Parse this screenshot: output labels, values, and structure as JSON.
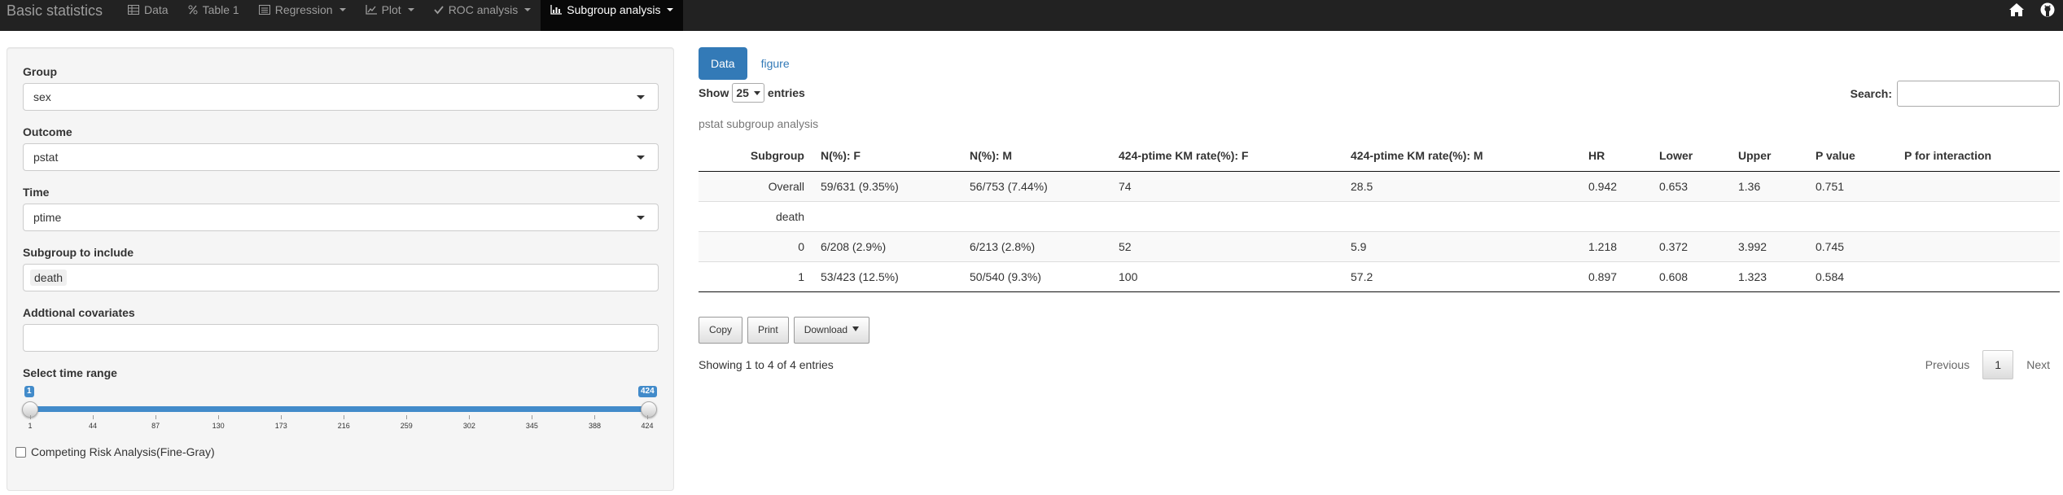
{
  "navbar": {
    "brand": "Basic statistics",
    "items": [
      {
        "label": "Data",
        "icon": "table-icon",
        "dropdown": false
      },
      {
        "label": "Table 1",
        "icon": "percent-icon",
        "dropdown": false
      },
      {
        "label": "Regression",
        "icon": "list-alt-icon",
        "dropdown": true
      },
      {
        "label": "Plot",
        "icon": "line-chart-icon",
        "dropdown": true
      },
      {
        "label": "ROC analysis",
        "icon": "check-icon",
        "dropdown": true
      },
      {
        "label": "Subgroup analysis",
        "icon": "bar-chart-icon",
        "dropdown": true,
        "active": true
      }
    ],
    "right_icons": [
      "home-icon",
      "github-icon"
    ]
  },
  "sidebar": {
    "group": {
      "label": "Group",
      "value": "sex"
    },
    "outcome": {
      "label": "Outcome",
      "value": "pstat"
    },
    "time": {
      "label": "Time",
      "value": "ptime"
    },
    "subgroup": {
      "label": "Subgroup to include",
      "tags": [
        "death"
      ]
    },
    "covariates": {
      "label": "Addtional covariates",
      "value": ""
    },
    "time_range": {
      "label": "Select time range",
      "min": 1,
      "max": 424,
      "from": 1,
      "to": 424,
      "ticks": [
        "1",
        "44",
        "87",
        "130",
        "173",
        "216",
        "259",
        "302",
        "345",
        "388",
        "424"
      ]
    },
    "competing_risk": {
      "label": "Competing Risk Analysis(Fine-Gray)",
      "checked": false
    }
  },
  "main": {
    "tabs": [
      {
        "label": "Data",
        "active": true
      },
      {
        "label": "figure",
        "active": false
      }
    ],
    "length": {
      "show_label": "Show",
      "value": "25",
      "entries_label": "entries"
    },
    "search": {
      "label": "Search:",
      "value": ""
    },
    "caption": "pstat subgroup analysis",
    "table": {
      "headers": [
        "Subgroup",
        "N(%): F",
        "N(%): M",
        "424-ptime KM rate(%): F",
        "424-ptime KM rate(%): M",
        "HR",
        "Lower",
        "Upper",
        "P value",
        "P for interaction"
      ],
      "rows": [
        [
          "Overall",
          "59/631 (9.35%)",
          "56/753 (7.44%)",
          "74",
          "28.5",
          "0.942",
          "0.653",
          "1.36",
          "0.751",
          ""
        ],
        [
          "death",
          "",
          "",
          "",
          "",
          "",
          "",
          "",
          "",
          ""
        ],
        [
          "0",
          "6/208 (2.9%)",
          "6/213 (2.8%)",
          "52",
          "5.9",
          "1.218",
          "0.372",
          "3.992",
          "0.745",
          ""
        ],
        [
          "1",
          "53/423 (12.5%)",
          "50/540 (9.3%)",
          "100",
          "57.2",
          "0.897",
          "0.608",
          "1.323",
          "0.584",
          ""
        ]
      ]
    },
    "buttons": {
      "copy": "Copy",
      "print": "Print",
      "download": "Download"
    },
    "info": "Showing 1 to 4 of 4 entries",
    "paging": {
      "previous": "Previous",
      "current": "1",
      "next": "Next"
    }
  },
  "colors": {
    "navbar_bg": "#222222",
    "navbar_active": "#080808",
    "accent": "#337ab7",
    "slider": "#428bca"
  }
}
